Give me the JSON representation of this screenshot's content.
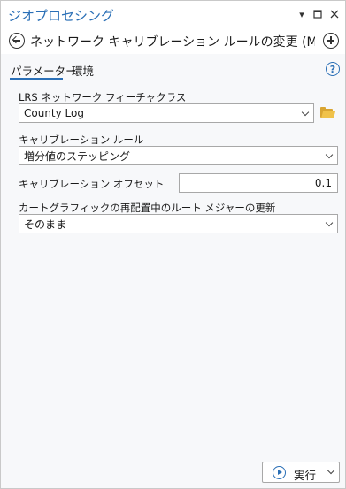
{
  "window": {
    "title": "ジオプロセシング",
    "menu_icon": "chevron-down-icon",
    "maximize_icon": "restore-icon",
    "close_icon": "close-icon"
  },
  "header": {
    "back_icon": "back-arrow-icon",
    "tool_title": "ネットワーク キャリブレーション ルールの変更 (Modify N...",
    "add_icon": "plus-circle-icon"
  },
  "tabs": [
    {
      "label": "パラメーター",
      "active": true
    },
    {
      "label": "環境",
      "active": false
    }
  ],
  "help_icon": "?",
  "parameters": {
    "lrs_network": {
      "label": "LRS ネットワーク フィーチャクラス",
      "value": "County Log"
    },
    "calibration_rule": {
      "label": "キャリブレーション ルール",
      "value": "増分値のステッピング"
    },
    "calibration_offset": {
      "label": "キャリブレーション オフセット",
      "value": "0.1"
    },
    "route_measure_update": {
      "label": "カートグラフィックの再配置中のルート メジャーの更新",
      "value": "そのまま"
    }
  },
  "run_button": {
    "label": "実行"
  },
  "colors": {
    "accent": "#2a6fb6",
    "folder": "#f0c24a",
    "panel_bg": "#f7f8fa"
  }
}
